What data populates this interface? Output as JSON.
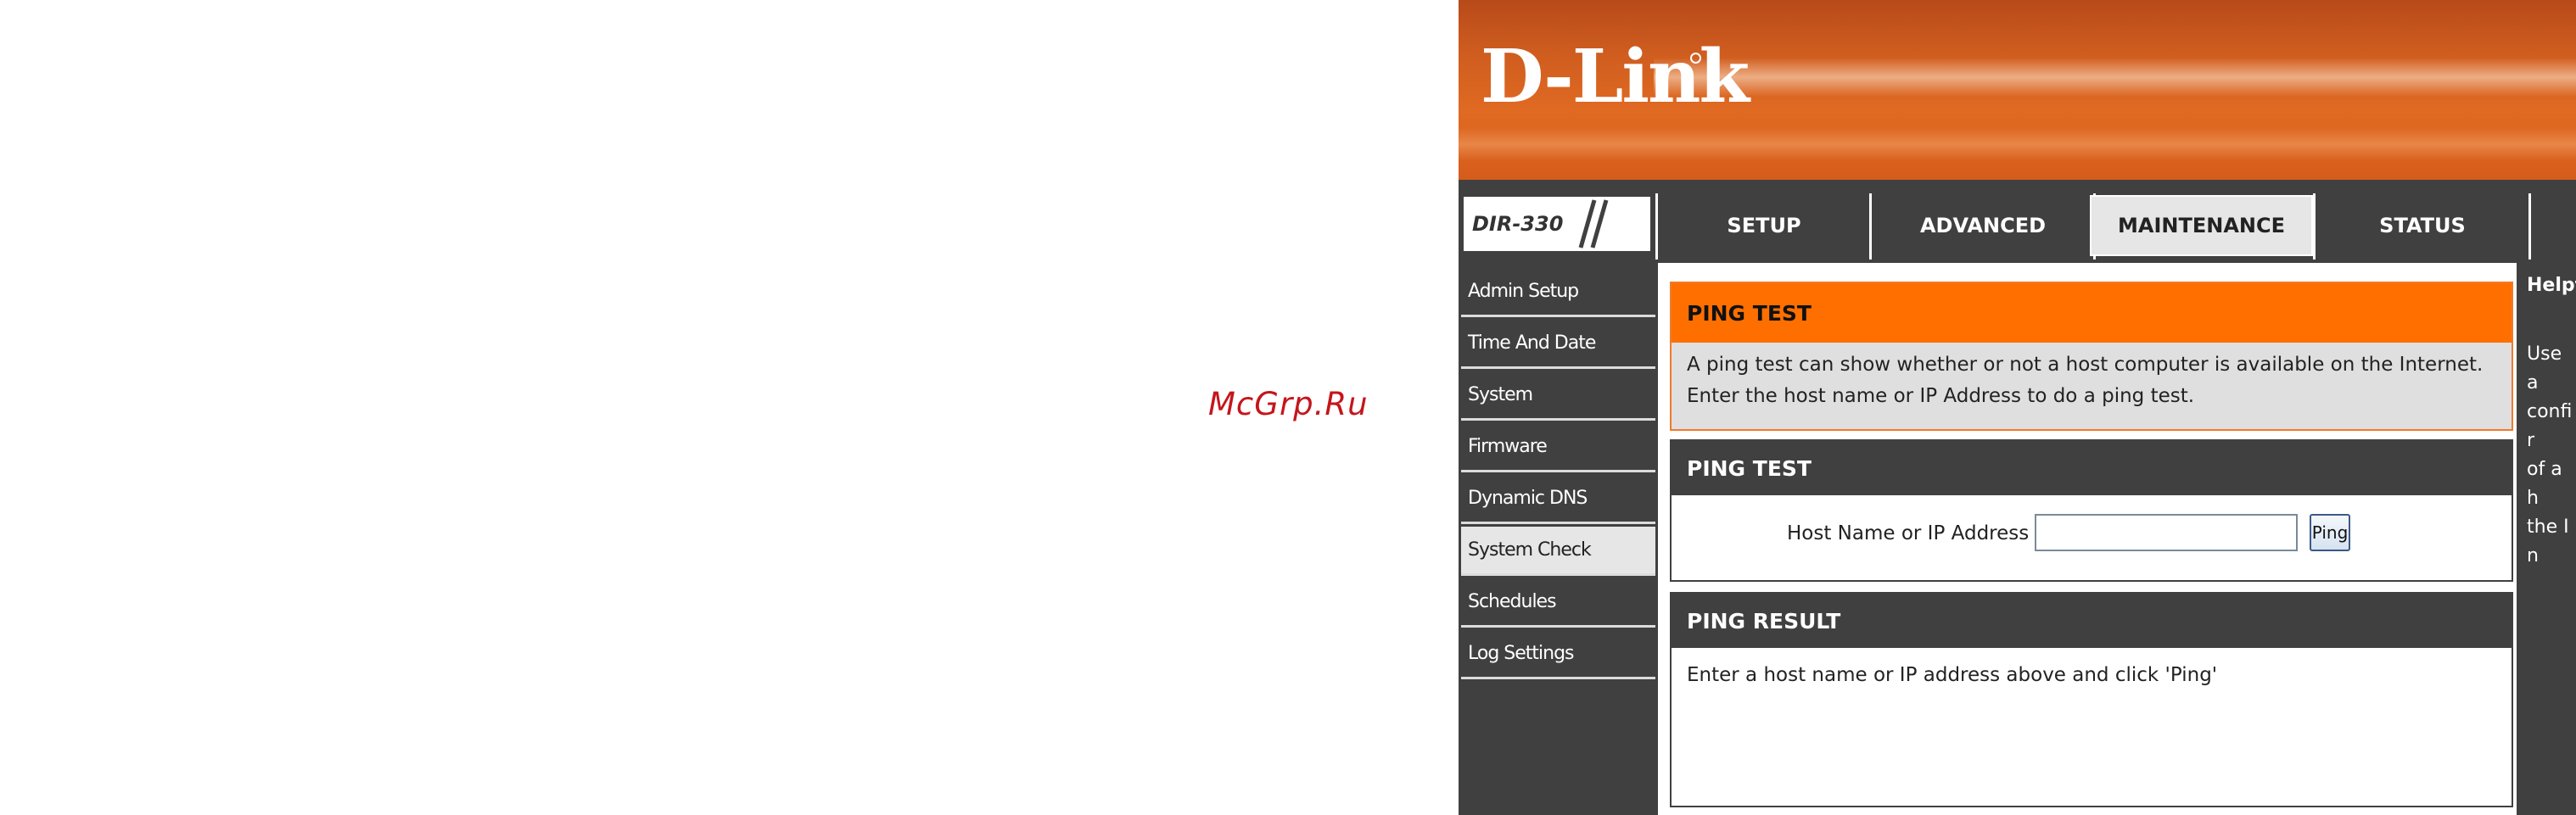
{
  "watermark": "McGrp.Ru",
  "brand": {
    "logo_text": "D-Link",
    "model": "DIR-330"
  },
  "tabs": [
    {
      "label": "SETUP",
      "active": false
    },
    {
      "label": "ADVANCED",
      "active": false
    },
    {
      "label": "MAINTENANCE",
      "active": true
    },
    {
      "label": "STATUS",
      "active": false
    }
  ],
  "sidebar": {
    "items": [
      {
        "label": "Admin Setup",
        "active": false
      },
      {
        "label": "Time And Date",
        "active": false
      },
      {
        "label": "System",
        "active": false
      },
      {
        "label": "Firmware",
        "active": false
      },
      {
        "label": "Dynamic DNS",
        "active": false
      },
      {
        "label": "System Check",
        "active": true
      },
      {
        "label": "Schedules",
        "active": false
      },
      {
        "label": "Log Settings",
        "active": false
      }
    ]
  },
  "intro": {
    "title": "PING TEST",
    "text": "A ping test can show whether or not a host computer is available on the Internet. Enter the host name or IP Address to do a ping test."
  },
  "ping_test": {
    "title": "PING TEST",
    "host_label": "Host Name or IP Address :",
    "host_value": "",
    "button_label": "Ping"
  },
  "ping_result": {
    "title": "PING RESULT",
    "text": "Enter a host name or IP address above and click 'Ping'"
  },
  "help": {
    "title": "Helpf",
    "lines": [
      "Use a",
      "confir",
      "of a h",
      "the In"
    ]
  },
  "colors": {
    "banner": "#d65c1b",
    "accent_orange": "#ff6f00",
    "dark_gray": "#404040",
    "active_tab": "#e6e6e6"
  }
}
